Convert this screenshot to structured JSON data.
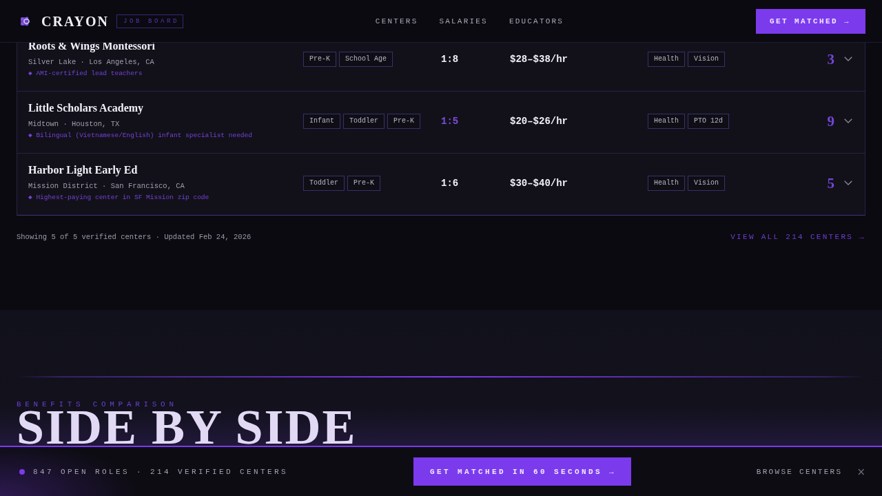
{
  "header": {
    "brand": "CRAYON",
    "badge": "JOB BOARD",
    "nav": [
      "CENTERS",
      "SALARIES",
      "EDUCATORS"
    ],
    "cta": "GET MATCHED →"
  },
  "centers": {
    "rows": [
      {
        "name": "Roots & Wings Montessori",
        "location": "Silver Lake · Los Angeles, CA",
        "note": "◆ AMI-certified lead teachers",
        "age_groups": [
          "Pre-K",
          "School Age"
        ],
        "ratio": "1:8",
        "ratio_highlighted": false,
        "pay": "$28–$38/hr",
        "benefits": [
          "Health",
          "Vision"
        ],
        "openings": "3"
      },
      {
        "name": "Little Scholars Academy",
        "location": "Midtown · Houston, TX",
        "note": "◆ Bilingual (Vietnamese/English) infant specialist needed",
        "age_groups": [
          "Infant",
          "Toddler",
          "Pre-K"
        ],
        "ratio": "1:5",
        "ratio_highlighted": true,
        "pay": "$20–$26/hr",
        "benefits": [
          "Health",
          "PTO 12d"
        ],
        "openings": "9"
      },
      {
        "name": "Harbor Light Early Ed",
        "location": "Mission District · San Francisco, CA",
        "note": "◆ Highest-paying center in SF Mission zip code",
        "age_groups": [
          "Toddler",
          "Pre-K"
        ],
        "ratio": "1:6",
        "ratio_highlighted": false,
        "pay": "$30–$40/hr",
        "benefits": [
          "Health",
          "Vision"
        ],
        "openings": "5"
      }
    ],
    "summary": "Showing 5 of 5 verified centers · Updated Feb 24, 2026",
    "view_all": "VIEW ALL 214 CENTERS →"
  },
  "benefits_section": {
    "eyebrow": "BENEFITS COMPARISON",
    "title": "SIDE BY SIDE"
  },
  "bottom_bar": {
    "stats": "847 OPEN ROLES · 214 VERIFIED CENTERS",
    "cta": "GET MATCHED IN 60 SECONDS →",
    "link": "BROWSE CENTERS",
    "close": "×"
  }
}
